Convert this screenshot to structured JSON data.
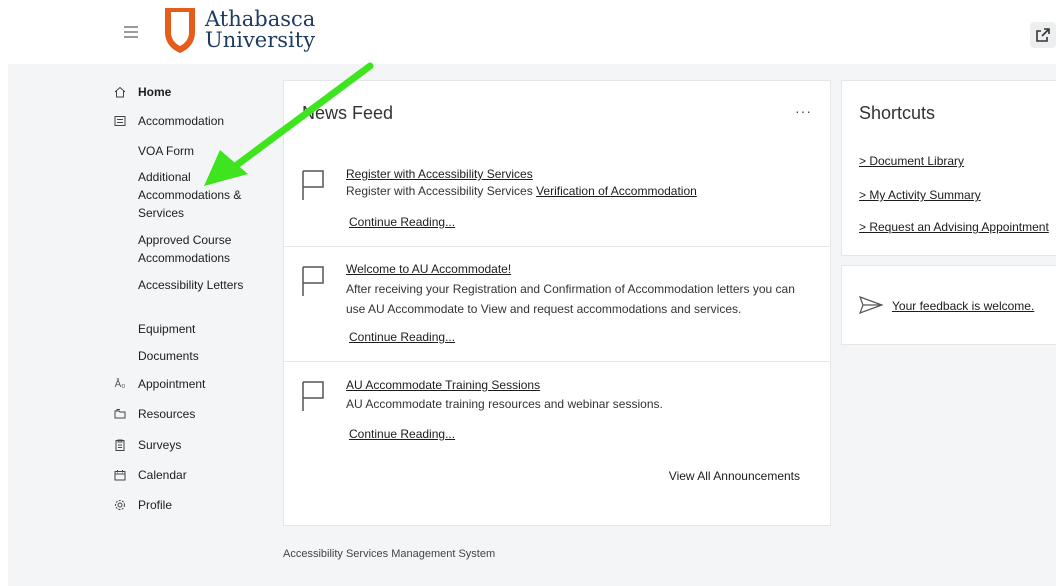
{
  "header": {
    "logo_line1": "Athabasca",
    "logo_line2": "University",
    "brand_color": "#e65c1a"
  },
  "sidebar": {
    "items": [
      {
        "label": "Home",
        "icon": "home-icon"
      },
      {
        "label": "Accommodation",
        "icon": "list-icon"
      },
      {
        "label": "Appointment",
        "icon": "appointment-icon"
      },
      {
        "label": "Resources",
        "icon": "folder-icon"
      },
      {
        "label": "Surveys",
        "icon": "clipboard-icon"
      },
      {
        "label": "Calendar",
        "icon": "calendar-icon"
      },
      {
        "label": "Profile",
        "icon": "gear-icon"
      }
    ],
    "sub_items": [
      "VOA Form",
      "Additional Accommodations & Services",
      "Approved Course Accommodations",
      "Accessibility Letters",
      "Equipment",
      "Documents"
    ]
  },
  "news": {
    "title": "News Feed",
    "menu": "···",
    "items": [
      {
        "title": "Register with Accessibility Services",
        "desc": "Register with Accessibility Services ",
        "desc_link": "Verification of Accommodation",
        "continue": "Continue Reading..."
      },
      {
        "title": "Welcome to AU Accommodate!",
        "desc": "After receiving your Registration and Confirmation of Accommodation letters you can use AU Accommodate to View and request accommodations and services.",
        "continue": "Continue Reading..."
      },
      {
        "title": "AU Accommodate Training Sessions",
        "desc": "AU Accommodate training resources and webinar sessions.",
        "continue": "Continue Reading..."
      }
    ],
    "view_all": "View All Announcements"
  },
  "shortcuts": {
    "title": "Shortcuts",
    "links": [
      "> Document Library",
      "> My Activity Summary",
      "> Request an Advising Appointment"
    ]
  },
  "feedback": {
    "link": "Your feedback is welcome.",
    "icon": "send-icon"
  },
  "footer": {
    "text": "Accessibility Services Management System"
  },
  "annotation": {
    "arrow_color": "#3ee51e"
  }
}
